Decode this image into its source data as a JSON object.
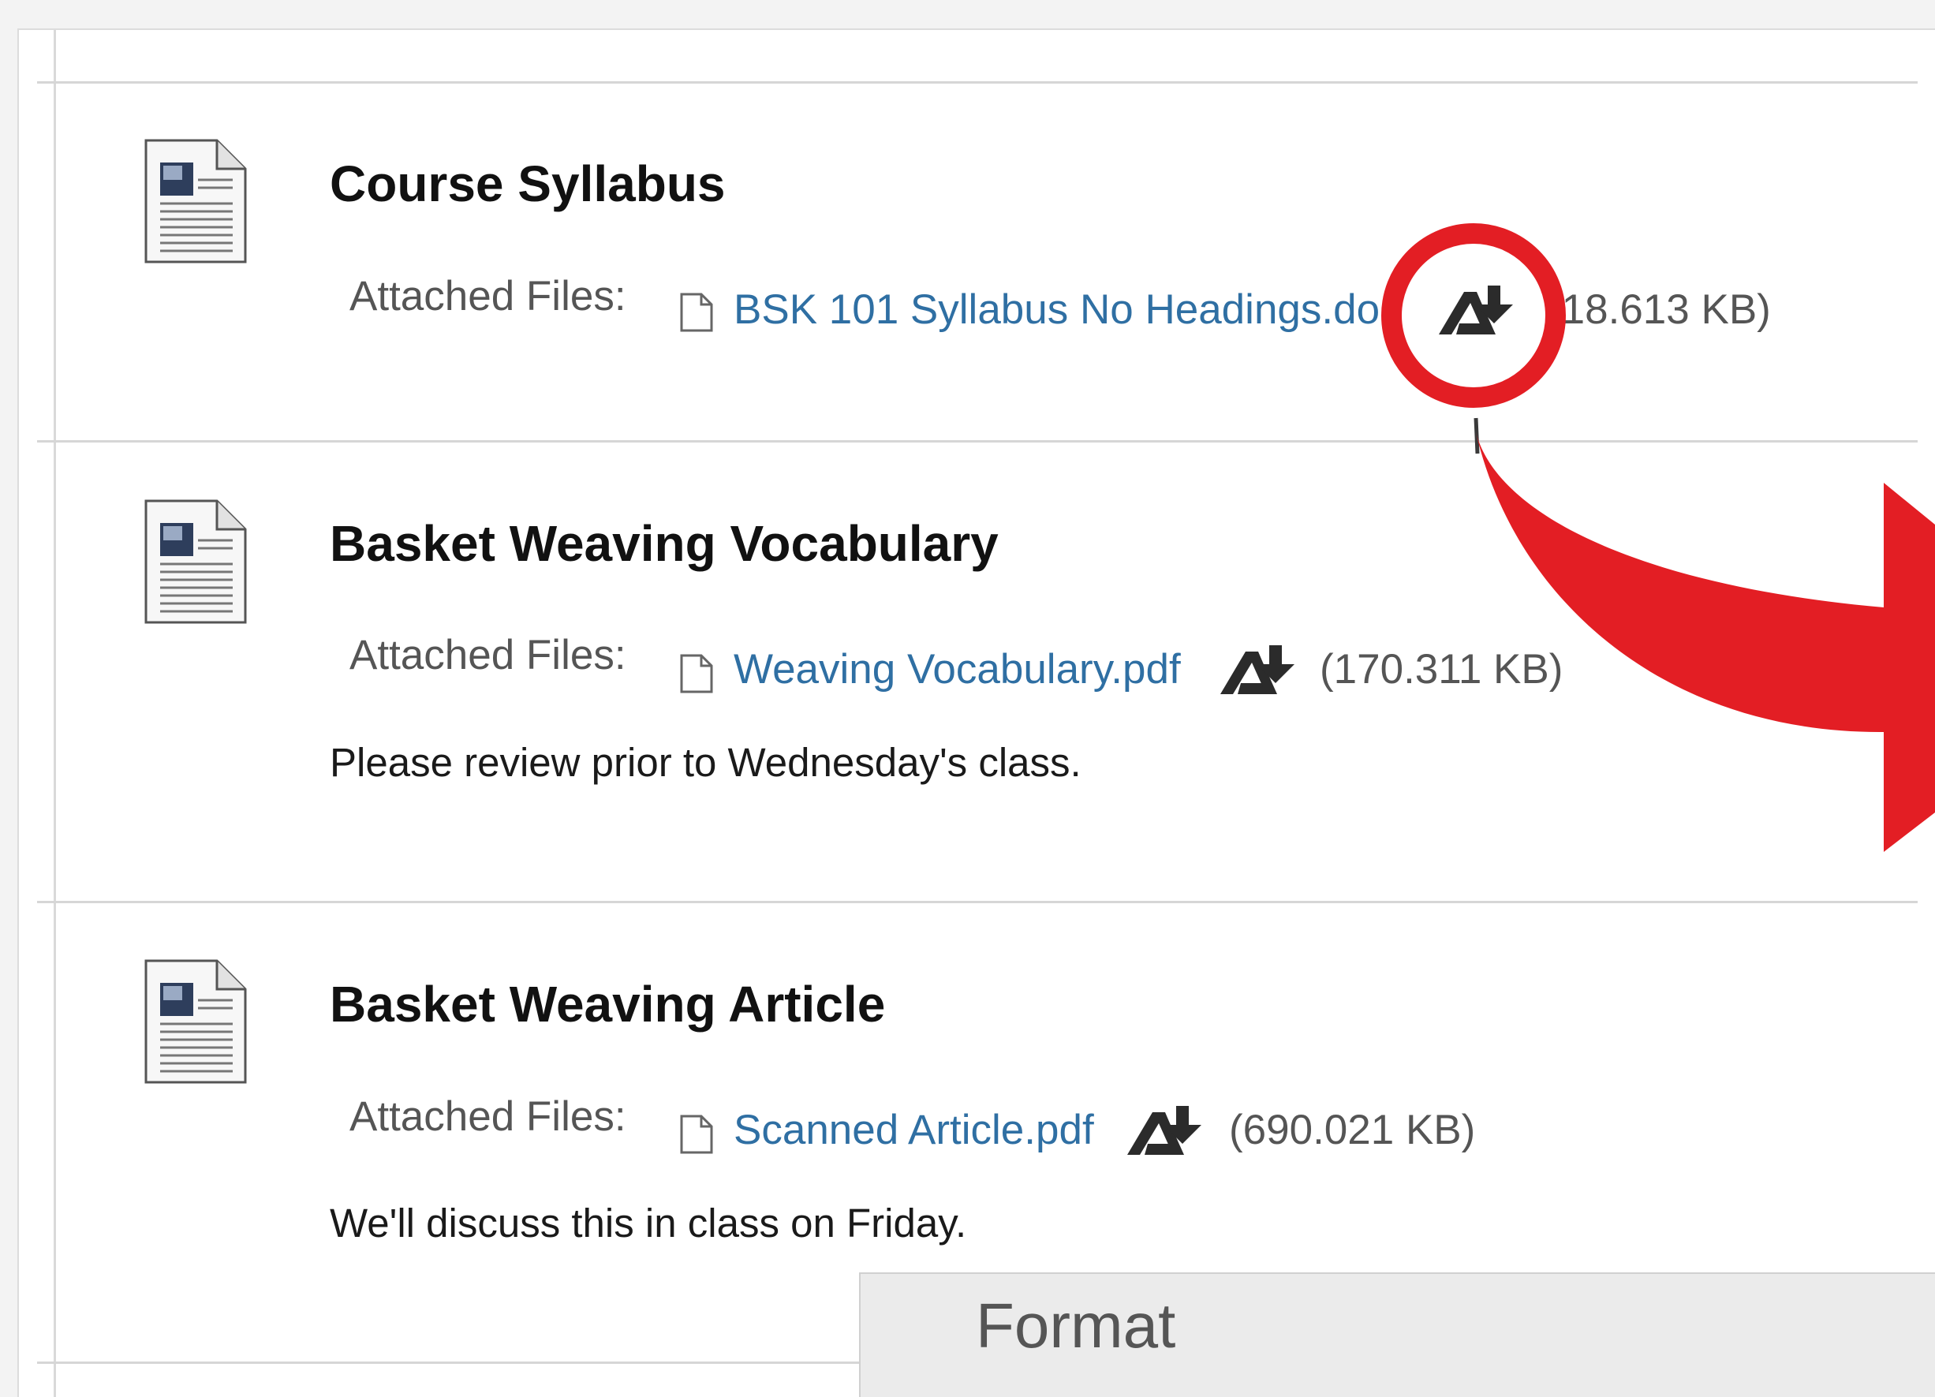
{
  "items": [
    {
      "title": "Course Syllabus",
      "attached_label": "Attached Files:",
      "file_name": "BSK 101 Syllabus No Headings.doc",
      "file_size": "(18.613 KB)",
      "description": ""
    },
    {
      "title": "Basket Weaving Vocabulary",
      "attached_label": "Attached Files:",
      "file_name": "Weaving Vocabulary.pdf",
      "file_size": "(170.311 KB)",
      "description": "Please review prior to Wednesday's class."
    },
    {
      "title": "Basket Weaving Article",
      "attached_label": "Attached Files:",
      "file_name": "Scanned Article.pdf",
      "file_size": "(690.021 KB)",
      "description": "We'll discuss this in class on Friday."
    }
  ],
  "format_menu": {
    "label": "Format"
  },
  "colors": {
    "link": "#2f6fa3",
    "annotation": "#e31e24",
    "ally_icon": "#2b2b2b"
  },
  "icons": [
    "document-icon",
    "file-icon",
    "alternative-formats-icon"
  ]
}
